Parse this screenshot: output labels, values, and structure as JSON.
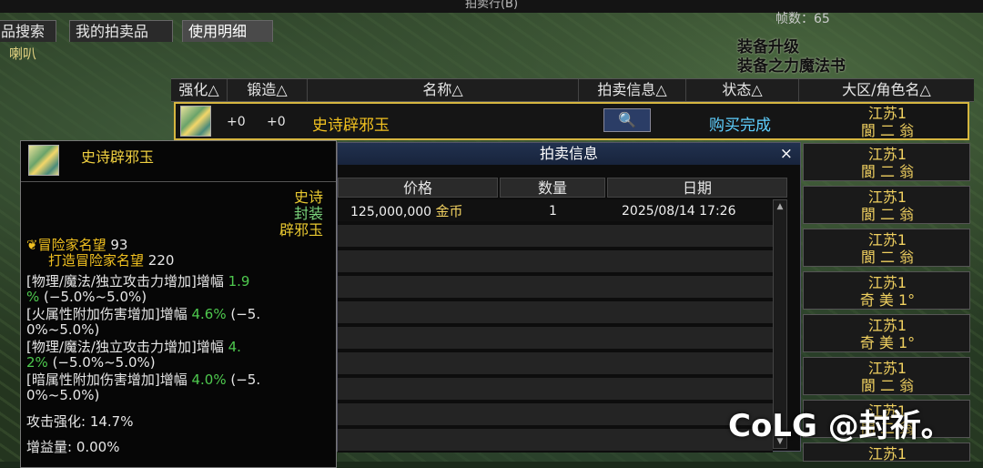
{
  "window": {
    "title": "拍卖行(B)"
  },
  "tabs": [
    {
      "label": "品搜索"
    },
    {
      "label": "我的拍卖品"
    },
    {
      "label": "使用明细"
    }
  ],
  "horn_label": "喇叭",
  "fps_text": "帧数：65",
  "buff": {
    "line1": "装备升级",
    "line2": "装备之力魔法书"
  },
  "table": {
    "headers": [
      "强化△",
      "锻造△",
      "名称△",
      "拍卖信息△",
      "状态△",
      "大区/角色名△"
    ],
    "row": {
      "reinforce": "+0",
      "forge": "+0",
      "name": "史诗辟邪玉",
      "search_icon": "🔍",
      "status": "购买完成"
    },
    "servers": [
      {
        "region": "江苏1",
        "char": "閬 二 翁"
      },
      {
        "region": "江苏1",
        "char": "閬 二 翁"
      },
      {
        "region": "江苏1",
        "char": "閬 二 翁"
      },
      {
        "region": "江苏1",
        "char": "閬 二 翁"
      },
      {
        "region": "江苏1",
        "char": "奇 美 1°"
      },
      {
        "region": "江苏1",
        "char": "奇 美 1°"
      },
      {
        "region": "江苏1",
        "char": "閬 二 翁"
      },
      {
        "region": "江苏1",
        "char": "閬 二 翁"
      },
      {
        "region": "江苏1",
        "char": ""
      }
    ]
  },
  "tooltip": {
    "name": "史诗辟邪玉",
    "grade": "史诗",
    "sealed": "封装",
    "type": "辟邪玉",
    "fame_label": "冒险家名望",
    "fame_value": "93",
    "forge_fame_label": "打造冒险家名望",
    "forge_fame_value": "220",
    "stats": [
      {
        "a": "[物理/魔法/独立攻击力增加]增幅 ",
        "v": "1.9",
        "b": ""
      },
      {
        "a": "",
        "v": "%",
        "b": " (−5.0%~5.0%)"
      },
      {
        "a": "[火属性附加伤害增加]增幅 ",
        "v": "4.6%",
        "b": " (−5."
      },
      {
        "a": "0%~5.0%)",
        "v": "",
        "b": ""
      },
      {
        "a": "[物理/魔法/独立攻击力增加]增幅 ",
        "v": "4.",
        "b": ""
      },
      {
        "a": "",
        "v": "2%",
        "b": " (−5.0%~5.0%)"
      },
      {
        "a": "[暗属性附加伤害增加]增幅 ",
        "v": "4.0%",
        "b": " (−5."
      },
      {
        "a": "0%~5.0%)",
        "v": "",
        "b": ""
      }
    ],
    "attack_label": "攻击强化: ",
    "attack_value": "14.7%",
    "buff_label": "增益量: ",
    "buff_value": "0.00%"
  },
  "dialog": {
    "title": "拍卖信息",
    "close": "×",
    "headers": [
      "价格",
      "数量",
      "日期"
    ],
    "price": "125,000,000",
    "currency": "金币",
    "quantity": "1",
    "date": "2025/08/14 17:26"
  },
  "watermark": "CoLG @封祈。"
}
